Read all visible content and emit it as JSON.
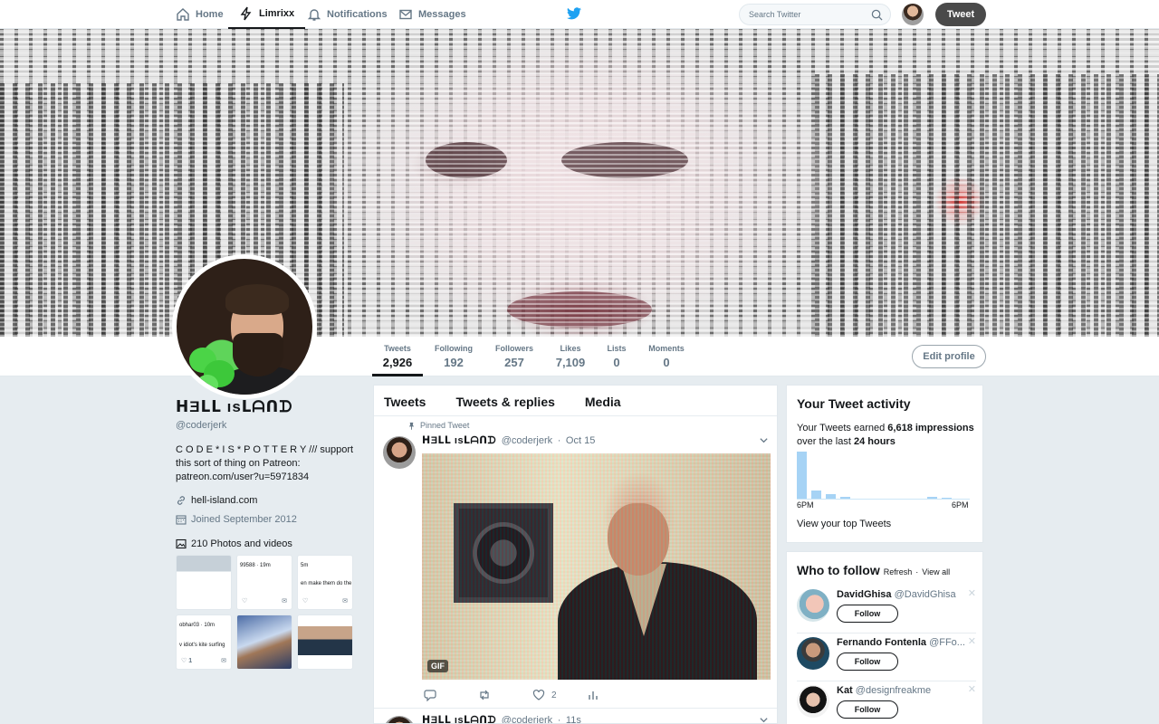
{
  "nav": {
    "items": [
      {
        "label": "Home",
        "icon": "home-icon"
      },
      {
        "label": "Limrixx",
        "icon": "bolt-icon"
      },
      {
        "label": "Notifications",
        "icon": "bell-icon"
      },
      {
        "label": "Messages",
        "icon": "envelope-icon"
      }
    ],
    "search_placeholder": "Search Twitter",
    "tweet_button": "Tweet"
  },
  "profile": {
    "name": "ᕼƎᒪᒪ ısᒪᗩᑎᗪ",
    "handle": "@coderjerk",
    "bio_line1": "C O D E * I S * P O T T E R Y /// support this sort of thing on Patreon:",
    "bio_link": "patreon.com/user?u=5971834",
    "website": "hell-island.com",
    "joined": "Joined September 2012",
    "photos_label": "210 Photos and videos",
    "edit_profile": "Edit profile"
  },
  "stats": [
    {
      "label": "Tweets",
      "value": "2,926"
    },
    {
      "label": "Following",
      "value": "192"
    },
    {
      "label": "Followers",
      "value": "257"
    },
    {
      "label": "Likes",
      "value": "7,109"
    },
    {
      "label": "Lists",
      "value": "0"
    },
    {
      "label": "Moments",
      "value": "0"
    }
  ],
  "thumbs": [
    {
      "text": "",
      "actions": false
    },
    {
      "text": "99588 · 19m",
      "actions": true,
      "count": ""
    },
    {
      "text": "5m",
      "sub": "en make them do the",
      "actions": true,
      "count": ""
    },
    {
      "text": "obhar03 · 10m",
      "sub": "v idiot's kite surfing",
      "actions": true,
      "count": "1"
    },
    {
      "text": "",
      "actions": false
    },
    {
      "text": "",
      "actions": false
    }
  ],
  "timeline": {
    "tabs": [
      "Tweets",
      "Tweets & replies",
      "Media"
    ],
    "pinned_label": "Pinned Tweet",
    "tweet1": {
      "name": "ᕼƎᒪᒪ ısᒪᗩᑎᗪ",
      "handle": "@coderjerk",
      "time": "Oct 15",
      "gif_badge": "GIF",
      "likes": "2"
    },
    "tweet2": {
      "name": "ᕼƎᒪᒪ ısᒪᗩᑎᗪ",
      "handle": "@coderjerk",
      "time": "11s"
    }
  },
  "activity": {
    "title": "Your Tweet activity",
    "text_pre": "Your Tweets earned ",
    "impressions": "6,618 impressions",
    "text_mid": " over the last ",
    "period": "24 hours",
    "axis_left": "6PM",
    "axis_right": "6PM",
    "link": "View your top Tweets"
  },
  "who_to_follow": {
    "title": "Who to follow",
    "refresh": "Refresh",
    "separator": "·",
    "view_all": "View all",
    "follow_label": "Follow",
    "people": [
      {
        "name": "DavidGhisa",
        "handle": "@DavidGhisa"
      },
      {
        "name": "Fernando Fontenla",
        "handle": "@FFo..."
      },
      {
        "name": "Kat",
        "handle": "@designfreakme"
      }
    ]
  },
  "colors": {
    "accent": "#1da1f2",
    "text": "#14171a",
    "muted": "#657786",
    "bg": "#e6ecf0"
  }
}
